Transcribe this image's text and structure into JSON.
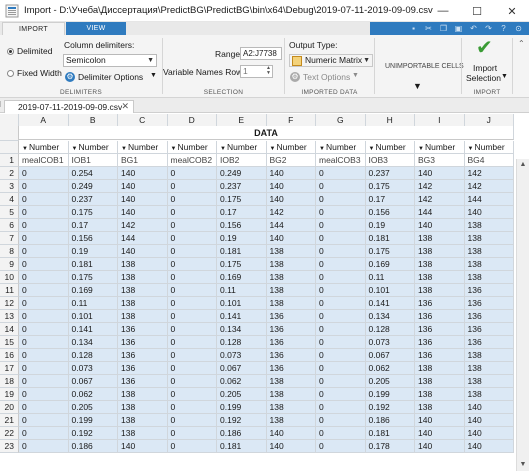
{
  "window": {
    "title": "Import - D:\\Учеба\\Диссертация\\PredictBG\\PredictBG\\bin\\x64\\Debug\\2019-07-11-2019-09-09.csv",
    "minimize": "—",
    "maximize": "☐",
    "close": "✕"
  },
  "tabs": {
    "import": "IMPORT",
    "view": "VIEW"
  },
  "ribbon": {
    "delimiters": {
      "delimited": "Delimited",
      "fixed_width": "Fixed Width",
      "column_delimiters_label": "Column delimiters:",
      "delimiter_value": "Semicolon",
      "delimiter_options": "Delimiter Options",
      "group_label": "DELIMITERS"
    },
    "selection": {
      "range_label": "Range:",
      "range_value": "A2:J7738",
      "var_names_label": "Variable Names Row:",
      "var_names_value": "1",
      "group_label": "SELECTION"
    },
    "imported_data": {
      "output_type_label": "Output Type:",
      "output_type_value": "Numeric Matrix",
      "text_options": "Text Options",
      "group_label": "IMPORTED DATA"
    },
    "unimportable": {
      "label": "UNIMPORTABLE CELLS"
    },
    "import": {
      "button_line1": "Import",
      "button_line2": "Selection",
      "group_label": "IMPORT"
    }
  },
  "document_tab": {
    "label": "2019-07-11-2019-09-09.csv"
  },
  "grid": {
    "data_header": "DATA",
    "columns": [
      "A",
      "B",
      "C",
      "D",
      "E",
      "F",
      "G",
      "H",
      "I",
      "J"
    ],
    "types": [
      "Number",
      "Number",
      "Number",
      "Number",
      "Number",
      "Number",
      "Number",
      "Number",
      "Number",
      "Number"
    ],
    "var_row_number": "1",
    "var_names": [
      "mealCOB1",
      "IOB1",
      "BG1",
      "mealCOB2",
      "IOB2",
      "BG2",
      "mealCOB3",
      "IOB3",
      "BG3",
      "BG4"
    ],
    "rows": [
      {
        "n": "2",
        "v": [
          "0",
          "0.254",
          "140",
          "0",
          "0.249",
          "140",
          "0",
          "0.237",
          "140",
          "142"
        ]
      },
      {
        "n": "3",
        "v": [
          "0",
          "0.249",
          "140",
          "0",
          "0.237",
          "140",
          "0",
          "0.175",
          "142",
          "142"
        ]
      },
      {
        "n": "4",
        "v": [
          "0",
          "0.237",
          "140",
          "0",
          "0.175",
          "140",
          "0",
          "0.17",
          "142",
          "144"
        ]
      },
      {
        "n": "5",
        "v": [
          "0",
          "0.175",
          "140",
          "0",
          "0.17",
          "142",
          "0",
          "0.156",
          "144",
          "140"
        ]
      },
      {
        "n": "6",
        "v": [
          "0",
          "0.17",
          "142",
          "0",
          "0.156",
          "144",
          "0",
          "0.19",
          "140",
          "138"
        ]
      },
      {
        "n": "7",
        "v": [
          "0",
          "0.156",
          "144",
          "0",
          "0.19",
          "140",
          "0",
          "0.181",
          "138",
          "138"
        ]
      },
      {
        "n": "8",
        "v": [
          "0",
          "0.19",
          "140",
          "0",
          "0.181",
          "138",
          "0",
          "0.175",
          "138",
          "138"
        ]
      },
      {
        "n": "9",
        "v": [
          "0",
          "0.181",
          "138",
          "0",
          "0.175",
          "138",
          "0",
          "0.169",
          "138",
          "138"
        ]
      },
      {
        "n": "10",
        "v": [
          "0",
          "0.175",
          "138",
          "0",
          "0.169",
          "138",
          "0",
          "0.11",
          "138",
          "138"
        ]
      },
      {
        "n": "11",
        "v": [
          "0",
          "0.169",
          "138",
          "0",
          "0.11",
          "138",
          "0",
          "0.101",
          "138",
          "136"
        ]
      },
      {
        "n": "12",
        "v": [
          "0",
          "0.11",
          "138",
          "0",
          "0.101",
          "138",
          "0",
          "0.141",
          "136",
          "136"
        ]
      },
      {
        "n": "13",
        "v": [
          "0",
          "0.101",
          "138",
          "0",
          "0.141",
          "136",
          "0",
          "0.134",
          "136",
          "136"
        ]
      },
      {
        "n": "14",
        "v": [
          "0",
          "0.141",
          "136",
          "0",
          "0.134",
          "136",
          "0",
          "0.128",
          "136",
          "136"
        ]
      },
      {
        "n": "15",
        "v": [
          "0",
          "0.134",
          "136",
          "0",
          "0.128",
          "136",
          "0",
          "0.073",
          "136",
          "136"
        ]
      },
      {
        "n": "16",
        "v": [
          "0",
          "0.128",
          "136",
          "0",
          "0.073",
          "136",
          "0",
          "0.067",
          "136",
          "138"
        ]
      },
      {
        "n": "17",
        "v": [
          "0",
          "0.073",
          "136",
          "0",
          "0.067",
          "136",
          "0",
          "0.062",
          "138",
          "138"
        ]
      },
      {
        "n": "18",
        "v": [
          "0",
          "0.067",
          "136",
          "0",
          "0.062",
          "138",
          "0",
          "0.205",
          "138",
          "138"
        ]
      },
      {
        "n": "19",
        "v": [
          "0",
          "0.062",
          "138",
          "0",
          "0.205",
          "138",
          "0",
          "0.199",
          "138",
          "138"
        ]
      },
      {
        "n": "20",
        "v": [
          "0",
          "0.205",
          "138",
          "0",
          "0.199",
          "138",
          "0",
          "0.192",
          "138",
          "140"
        ]
      },
      {
        "n": "21",
        "v": [
          "0",
          "0.199",
          "138",
          "0",
          "0.192",
          "138",
          "0",
          "0.186",
          "140",
          "140"
        ]
      },
      {
        "n": "22",
        "v": [
          "0",
          "0.192",
          "138",
          "0",
          "0.186",
          "140",
          "0",
          "0.181",
          "140",
          "140"
        ]
      },
      {
        "n": "23",
        "v": [
          "0",
          "0.186",
          "140",
          "0",
          "0.181",
          "140",
          "0",
          "0.178",
          "140",
          "140"
        ]
      }
    ]
  },
  "colors": {
    "accent": "#2f7bbf",
    "selection_fill": "#dbe8f5",
    "check_green": "#3a9b35"
  }
}
